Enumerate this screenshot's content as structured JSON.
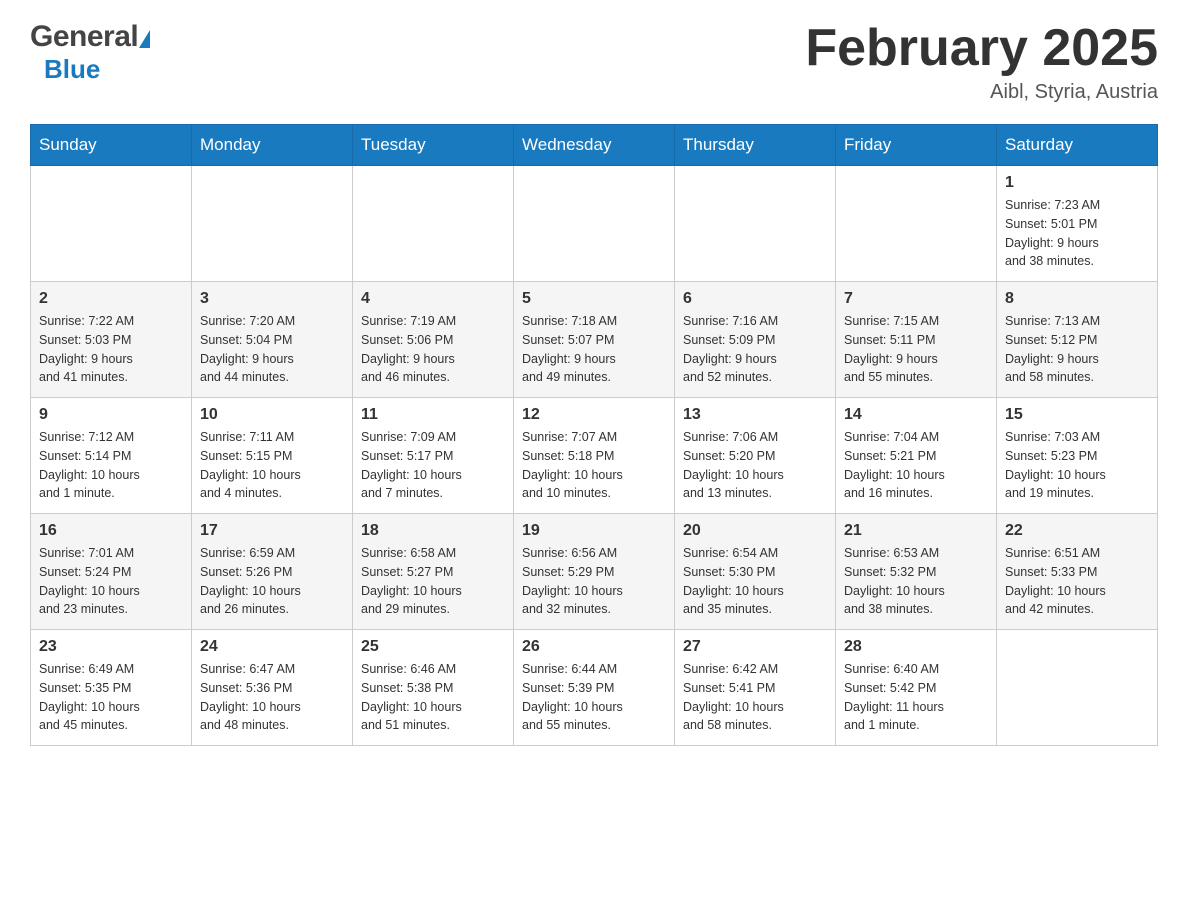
{
  "header": {
    "logo": {
      "general_text": "General",
      "blue_text": "Blue"
    },
    "month_title": "February 2025",
    "location": "Aibl, Styria, Austria"
  },
  "calendar": {
    "days_of_week": [
      "Sunday",
      "Monday",
      "Tuesday",
      "Wednesday",
      "Thursday",
      "Friday",
      "Saturday"
    ],
    "weeks": [
      [
        {
          "day": "",
          "info": ""
        },
        {
          "day": "",
          "info": ""
        },
        {
          "day": "",
          "info": ""
        },
        {
          "day": "",
          "info": ""
        },
        {
          "day": "",
          "info": ""
        },
        {
          "day": "",
          "info": ""
        },
        {
          "day": "1",
          "info": "Sunrise: 7:23 AM\nSunset: 5:01 PM\nDaylight: 9 hours\nand 38 minutes."
        }
      ],
      [
        {
          "day": "2",
          "info": "Sunrise: 7:22 AM\nSunset: 5:03 PM\nDaylight: 9 hours\nand 41 minutes."
        },
        {
          "day": "3",
          "info": "Sunrise: 7:20 AM\nSunset: 5:04 PM\nDaylight: 9 hours\nand 44 minutes."
        },
        {
          "day": "4",
          "info": "Sunrise: 7:19 AM\nSunset: 5:06 PM\nDaylight: 9 hours\nand 46 minutes."
        },
        {
          "day": "5",
          "info": "Sunrise: 7:18 AM\nSunset: 5:07 PM\nDaylight: 9 hours\nand 49 minutes."
        },
        {
          "day": "6",
          "info": "Sunrise: 7:16 AM\nSunset: 5:09 PM\nDaylight: 9 hours\nand 52 minutes."
        },
        {
          "day": "7",
          "info": "Sunrise: 7:15 AM\nSunset: 5:11 PM\nDaylight: 9 hours\nand 55 minutes."
        },
        {
          "day": "8",
          "info": "Sunrise: 7:13 AM\nSunset: 5:12 PM\nDaylight: 9 hours\nand 58 minutes."
        }
      ],
      [
        {
          "day": "9",
          "info": "Sunrise: 7:12 AM\nSunset: 5:14 PM\nDaylight: 10 hours\nand 1 minute."
        },
        {
          "day": "10",
          "info": "Sunrise: 7:11 AM\nSunset: 5:15 PM\nDaylight: 10 hours\nand 4 minutes."
        },
        {
          "day": "11",
          "info": "Sunrise: 7:09 AM\nSunset: 5:17 PM\nDaylight: 10 hours\nand 7 minutes."
        },
        {
          "day": "12",
          "info": "Sunrise: 7:07 AM\nSunset: 5:18 PM\nDaylight: 10 hours\nand 10 minutes."
        },
        {
          "day": "13",
          "info": "Sunrise: 7:06 AM\nSunset: 5:20 PM\nDaylight: 10 hours\nand 13 minutes."
        },
        {
          "day": "14",
          "info": "Sunrise: 7:04 AM\nSunset: 5:21 PM\nDaylight: 10 hours\nand 16 minutes."
        },
        {
          "day": "15",
          "info": "Sunrise: 7:03 AM\nSunset: 5:23 PM\nDaylight: 10 hours\nand 19 minutes."
        }
      ],
      [
        {
          "day": "16",
          "info": "Sunrise: 7:01 AM\nSunset: 5:24 PM\nDaylight: 10 hours\nand 23 minutes."
        },
        {
          "day": "17",
          "info": "Sunrise: 6:59 AM\nSunset: 5:26 PM\nDaylight: 10 hours\nand 26 minutes."
        },
        {
          "day": "18",
          "info": "Sunrise: 6:58 AM\nSunset: 5:27 PM\nDaylight: 10 hours\nand 29 minutes."
        },
        {
          "day": "19",
          "info": "Sunrise: 6:56 AM\nSunset: 5:29 PM\nDaylight: 10 hours\nand 32 minutes."
        },
        {
          "day": "20",
          "info": "Sunrise: 6:54 AM\nSunset: 5:30 PM\nDaylight: 10 hours\nand 35 minutes."
        },
        {
          "day": "21",
          "info": "Sunrise: 6:53 AM\nSunset: 5:32 PM\nDaylight: 10 hours\nand 38 minutes."
        },
        {
          "day": "22",
          "info": "Sunrise: 6:51 AM\nSunset: 5:33 PM\nDaylight: 10 hours\nand 42 minutes."
        }
      ],
      [
        {
          "day": "23",
          "info": "Sunrise: 6:49 AM\nSunset: 5:35 PM\nDaylight: 10 hours\nand 45 minutes."
        },
        {
          "day": "24",
          "info": "Sunrise: 6:47 AM\nSunset: 5:36 PM\nDaylight: 10 hours\nand 48 minutes."
        },
        {
          "day": "25",
          "info": "Sunrise: 6:46 AM\nSunset: 5:38 PM\nDaylight: 10 hours\nand 51 minutes."
        },
        {
          "day": "26",
          "info": "Sunrise: 6:44 AM\nSunset: 5:39 PM\nDaylight: 10 hours\nand 55 minutes."
        },
        {
          "day": "27",
          "info": "Sunrise: 6:42 AM\nSunset: 5:41 PM\nDaylight: 10 hours\nand 58 minutes."
        },
        {
          "day": "28",
          "info": "Sunrise: 6:40 AM\nSunset: 5:42 PM\nDaylight: 11 hours\nand 1 minute."
        },
        {
          "day": "",
          "info": ""
        }
      ]
    ]
  }
}
